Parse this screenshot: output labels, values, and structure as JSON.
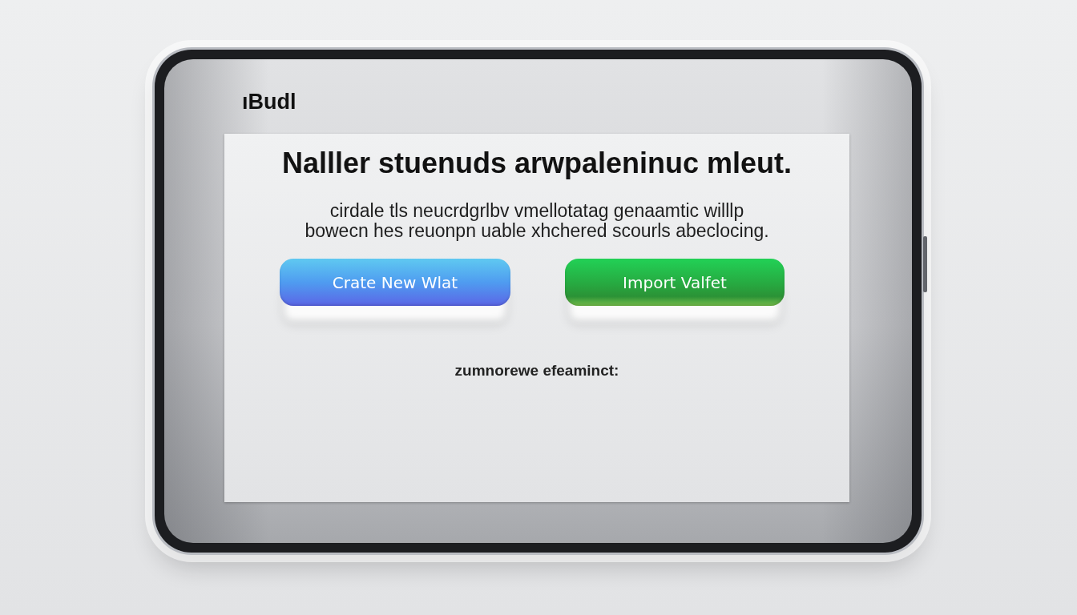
{
  "logo": {
    "text": "ıBudl"
  },
  "card": {
    "title": "Nalller stuenuds arwpaleninuc mleut.",
    "description": "cirdale tls neucrdgrlbv vmellotatag genaamtic willlp\nbowecn hes reuonpn uable xhchered scourls abeclocing.",
    "buttons": [
      {
        "label": "Crate New Wlat",
        "kind": "primary"
      },
      {
        "label": "Import Valfet",
        "kind": "secondary"
      }
    ],
    "footnote": "zumnorewe efeaminct:"
  }
}
